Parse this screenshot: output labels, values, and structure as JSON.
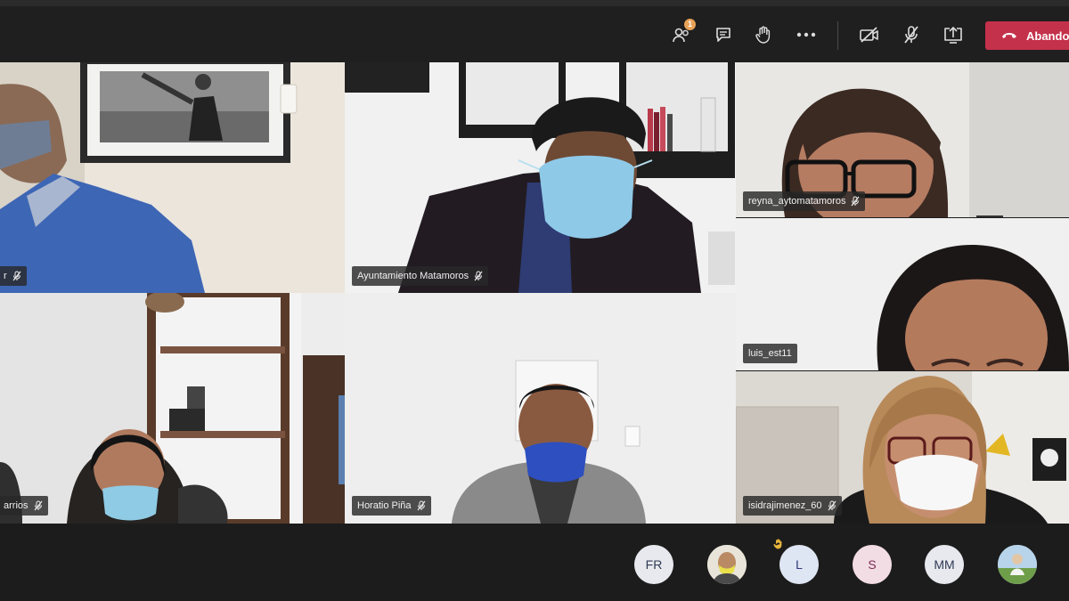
{
  "toolbar": {
    "participants_badge": "1",
    "leave_label": "Abando"
  },
  "tiles": [
    {
      "name": "r"
    },
    {
      "name": "Ayuntamiento Matamoros"
    },
    {
      "name": "reyna_aytomatamoros"
    },
    {
      "name": "luis_est11"
    },
    {
      "name": "arrios"
    },
    {
      "name": "Horatio Piña"
    },
    {
      "name": "isidrajimenez_60"
    }
  ],
  "participants_strip": [
    {
      "label": "FR"
    },
    {
      "label": ""
    },
    {
      "label": "L"
    },
    {
      "label": "S"
    },
    {
      "label": "MM"
    },
    {
      "label": ""
    }
  ],
  "colors": {
    "leave": "#c4314b",
    "bar_bg": "#1f1f1f",
    "badge": "#e9a257"
  },
  "icons": [
    "participants-icon",
    "chat-icon",
    "raise-hand-icon",
    "more-options-icon",
    "camera-off-icon",
    "mic-off-icon",
    "share-screen-icon",
    "hang-up-icon"
  ]
}
